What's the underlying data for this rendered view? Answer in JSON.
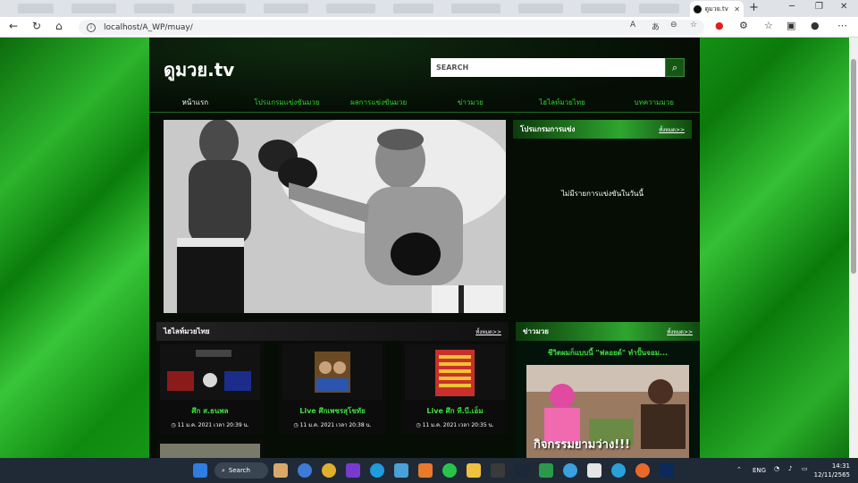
{
  "browser": {
    "active_tab_title": "ดูมวย.tv",
    "url": "localhost/A_WP/muay/",
    "new_tab_symbol": "+",
    "window_controls": [
      "─",
      "❐",
      "✕"
    ]
  },
  "site": {
    "logo": "ดูมวย.tv",
    "search_placeholder": "SEARCH",
    "nav": [
      "หน้าแรก",
      "โปรแกรมแข่งขันมวย",
      "ผลการแข่งขันมวย",
      "ข่าวมวย",
      "ไฮไลท์มวยไทย",
      "บทความมวย"
    ],
    "program_panel": {
      "title": "โปรแกรมการแข่ง",
      "link": "ทั้งหมด>>",
      "empty_message": "ไม่มีรายการแข่งขันในวันนี้"
    },
    "highlight_panel": {
      "title": "ไฮไลท์มวยไทย",
      "link": "ทั้งหมด>>",
      "cards": [
        {
          "title": "ศึก ส.ธนพล",
          "date": "11 ม.ค. 2021 เวลา 20:39 น."
        },
        {
          "title": "Live ศึกเพชรสุโขทัย",
          "date": "11 ม.ค. 2021 เวลา 20:38 น."
        },
        {
          "title": "Live ศึก ที.บี.เอ็ม",
          "date": "11 ม.ค. 2021 เวลา 20:35 น."
        }
      ]
    },
    "news_panel": {
      "title": "ข่าวมวย",
      "link": "ทั้งหมด>>",
      "headline": "ชีวิตผมก็แบบนี้ \"ฟลอยด์\" ทำปั้นจอม...",
      "image_caption": "กิจกรรมยามว่าง!!!"
    }
  },
  "taskbar": {
    "search_label": "Search",
    "language": "ENG",
    "time": "14:31",
    "date": "12/11/2565"
  },
  "colors": {
    "accent_green": "#2fd52f",
    "panel_green": "#2fa52f",
    "site_bg": "#050d05"
  }
}
